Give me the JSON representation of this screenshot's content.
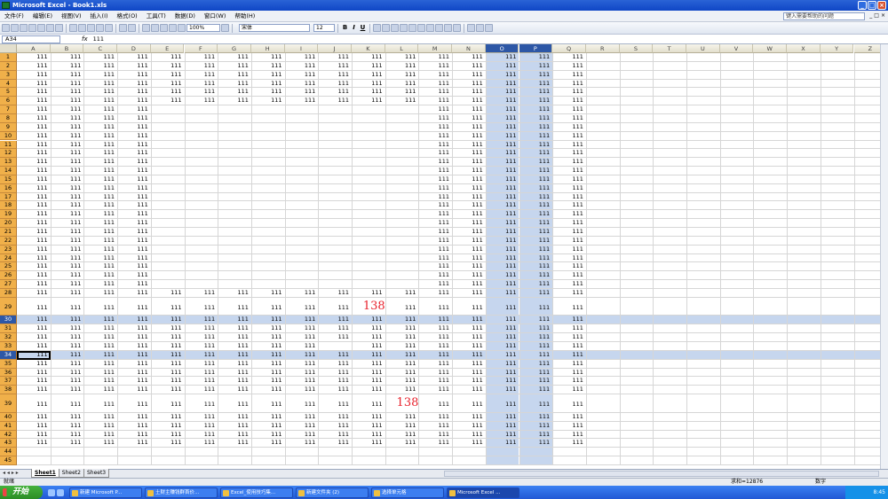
{
  "title": "Microsoft Excel - Book1.xls",
  "menus": [
    "文件(F)",
    "编辑(E)",
    "视图(V)",
    "插入(I)",
    "格式(O)",
    "工具(T)",
    "数据(D)",
    "窗口(W)",
    "帮助(H)"
  ],
  "help_placeholder": "键入需要帮助的问题",
  "toolbar": {
    "zoom": "100%",
    "font": "宋体",
    "size": "12"
  },
  "namebox": "A34",
  "formula": "111",
  "fx": "fx",
  "columns": [
    "A",
    "B",
    "C",
    "D",
    "E",
    "F",
    "G",
    "H",
    "I",
    "J",
    "K",
    "L",
    "M",
    "N",
    "O",
    "P",
    "Q",
    "R",
    "S",
    "T",
    "U",
    "V",
    "W",
    "X",
    "Y",
    "Z"
  ],
  "selected_columns": [
    "O",
    "P"
  ],
  "selected_rows": [
    30,
    34
  ],
  "active_cell": "A34",
  "cell_value": "111",
  "blocks": [
    {
      "rows": [
        1,
        6
      ],
      "cols": [
        "A",
        "Q"
      ]
    },
    {
      "rows": [
        7,
        27
      ],
      "cols": [
        "A",
        "D"
      ]
    },
    {
      "rows": [
        7,
        27
      ],
      "cols": [
        "M",
        "Q"
      ]
    },
    {
      "rows": [
        28,
        43
      ],
      "cols": [
        "A",
        "Q"
      ]
    }
  ],
  "special_cells": [
    {
      "row": 29,
      "col": "K",
      "text": "138"
    },
    {
      "row": 39,
      "col": "L",
      "text": "138"
    },
    {
      "row": 33,
      "col": "J",
      "text": ""
    }
  ],
  "row_count": 45,
  "sheets": [
    "Sheet1",
    "Sheet2",
    "Sheet3"
  ],
  "active_sheet": "Sheet1",
  "status": {
    "left": "就绪",
    "sum": "求和=12876",
    "mode": "数字"
  },
  "taskbar": {
    "start": "开始",
    "tasks": [
      "新建 Microsoft P...",
      "土财主赚钱群首价...",
      "Excel_使用技巧集...",
      "新建文件夹 (2)",
      "选择单元格",
      "Microsoft Excel ..."
    ],
    "active_task": 5,
    "clock": "8:45"
  }
}
